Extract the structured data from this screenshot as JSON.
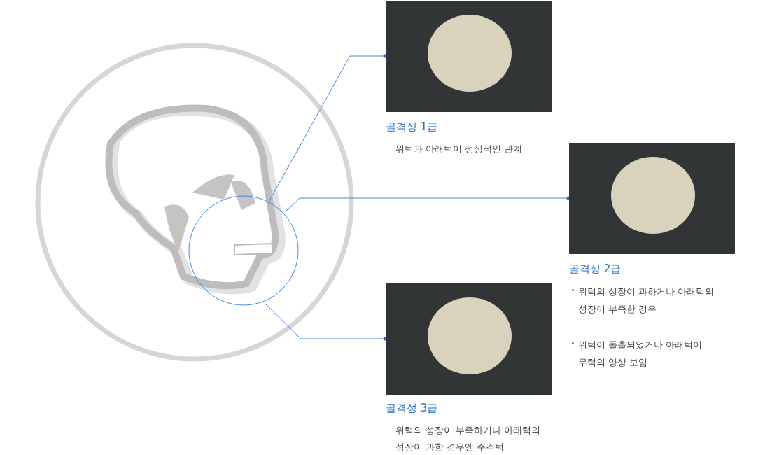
{
  "cards": [
    {
      "kind": "plain",
      "title": "골격성 1급",
      "texts": [
        "위턱과 아래턱이 정상적인 관계"
      ]
    },
    {
      "kind": "bullets",
      "title": "골격성 2급",
      "texts": [
        "위턱의 성장이 과하거나 아래턱의\n성장이 부족한 경우",
        "위턱이 돌출되었거나 아래턱이\n무턱의 양상 보임"
      ]
    },
    {
      "kind": "plain",
      "title": "골격성 3급",
      "texts": [
        "위턱의 성장이 부족하거나 아래턱의\n성장이 과한 경우엔 주걱턱"
      ]
    }
  ]
}
